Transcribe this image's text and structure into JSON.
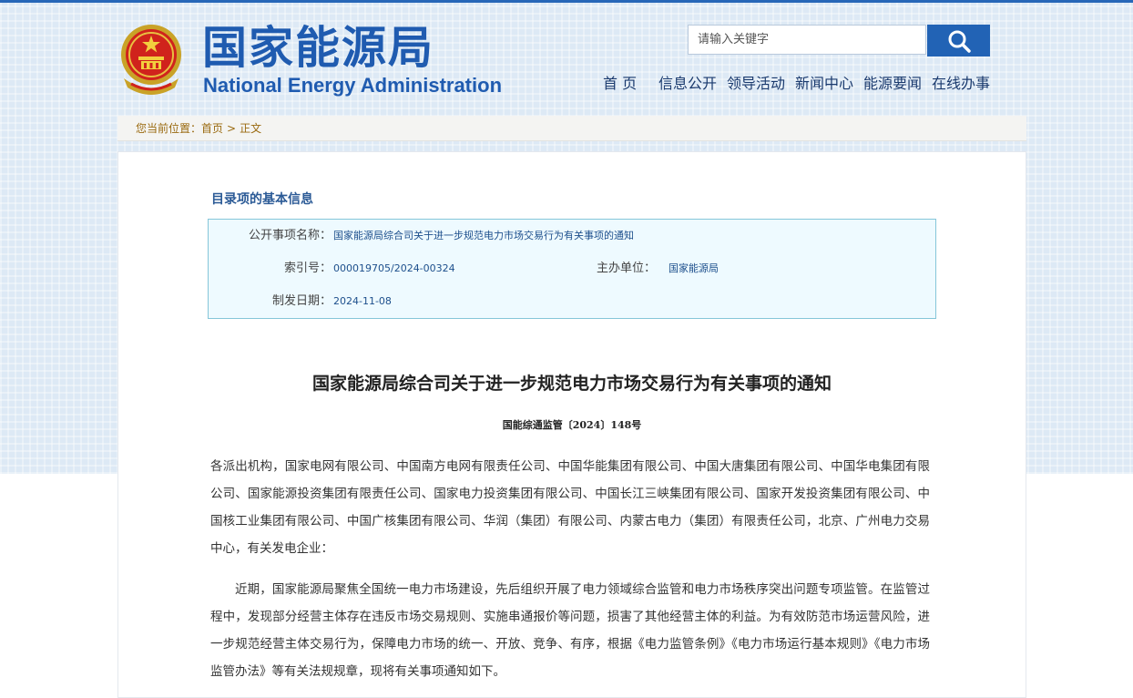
{
  "header": {
    "site_title_cn": "国家能源局",
    "site_title_en": "National Energy Administration",
    "search": {
      "placeholder": "请输入关键字",
      "button_icon": "search-icon"
    },
    "nav": [
      "首 页",
      "信息公开",
      "领导活动",
      "新闻中心",
      "能源要闻",
      "在线办事"
    ]
  },
  "breadcrumb": {
    "prefix": "您当前位置：",
    "items": [
      "首页",
      "正文"
    ]
  },
  "info": {
    "section_title": "目录项的基本信息",
    "fields": {
      "name_label": "公开事项名称：",
      "name_value": "国家能源局综合司关于进一步规范电力市场交易行为有关事项的通知",
      "index_label": "索引号：",
      "index_value": "000019705/2024-00324",
      "unit_label": "主办单位：",
      "unit_value": "国家能源局",
      "date_label": "制发日期：",
      "date_value": "2024-11-08"
    }
  },
  "document": {
    "title": "国家能源局综合司关于进一步规范电力市场交易行为有关事项的通知",
    "number": "国能综通监管〔2024〕148号",
    "paragraphs": [
      "各派出机构，国家电网有限公司、中国南方电网有限责任公司、中国华能集团有限公司、中国大唐集团有限公司、中国华电集团有限公司、国家能源投资集团有限责任公司、国家电力投资集团有限公司、中国长江三峡集团有限公司、国家开发投资集团有限公司、中国核工业集团有限公司、中国广核集团有限公司、华润（集团）有限公司、内蒙古电力（集团）有限责任公司，北京、广州电力交易中心，有关发电企业：",
      "近期，国家能源局聚焦全国统一电力市场建设，先后组织开展了电力领域综合监管和电力市场秩序突出问题专项监管。在监管过程中，发现部分经营主体存在违反市场交易规则、实施串通报价等问题，损害了其他经营主体的利益。为有效防范市场运营风险，进一步规范经营主体交易行为，保障电力市场的统一、开放、竞争、有序，根据《电力监管条例》《电力市场运行基本规则》《电力市场监管办法》等有关法规规章，现将有关事项通知如下。"
    ]
  },
  "colors": {
    "brand_blue": "#1f5bb0",
    "search_button": "#2263b5",
    "breadcrumb_text": "#9a6a10",
    "info_border": "#85c6d9",
    "info_bg": "#eefaff"
  }
}
